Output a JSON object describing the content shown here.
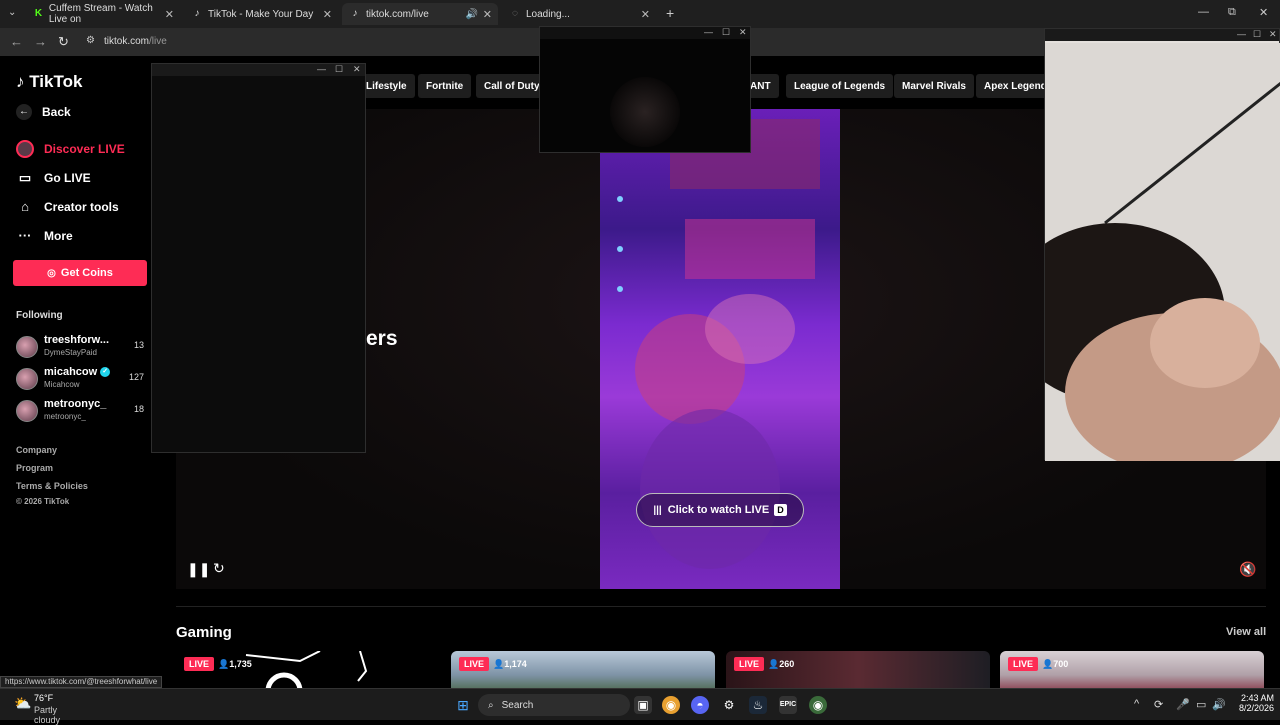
{
  "browser": {
    "tabs": [
      {
        "title": "Cuffem Stream - Watch Live on",
        "icon": "kick-icon"
      },
      {
        "title": "TikTok - Make Your Day",
        "icon": "tiktok-icon"
      },
      {
        "title": "tiktok.com/live",
        "icon": "tiktok-icon",
        "active": true
      },
      {
        "title": "Loading...",
        "icon": "loading-icon"
      }
    ],
    "url_host": "tiktok.com",
    "url_path": "/live"
  },
  "sidebar": {
    "logo": "TikTok",
    "back": "Back",
    "nav": [
      "Discover LIVE",
      "Go LIVE",
      "Creator tools",
      "More"
    ],
    "get_coins": "Get Coins",
    "following_label": "Following",
    "following": [
      {
        "name": "treeshforw...",
        "sub": "DymeStayPaid",
        "count": "13"
      },
      {
        "name": "micahcow",
        "sub": "Micahcow",
        "count": "127",
        "verified": true
      },
      {
        "name": "metroonyc_",
        "sub": "metroonyc_",
        "count": "18"
      }
    ],
    "footer": [
      "Company",
      "Program",
      "Terms & Policies",
      "© 2026 TikTok"
    ]
  },
  "categories": [
    "Lifestyle",
    "Fortnite",
    "Call of Duty",
    "ANT",
    "League of Legends",
    "Marvel Rivals",
    "Apex Legends"
  ],
  "hero": {
    "title_fragment": "ers",
    "watch_label": "Click to watch LIVE",
    "watch_key": "D"
  },
  "gaming": {
    "title": "Gaming",
    "view_all": "View all",
    "cards": [
      {
        "live": "LIVE",
        "viewers": "1,735"
      },
      {
        "live": "LIVE",
        "viewers": "1,174"
      },
      {
        "live": "LIVE",
        "viewers": "260"
      },
      {
        "live": "LIVE",
        "viewers": "700"
      }
    ]
  },
  "status_url": "https://www.tiktok.com/@treeshforwhat/live",
  "taskbar": {
    "temp": "76°F",
    "condition": "Partly cloudy",
    "search": "Search",
    "time": "2:43 AM",
    "date": "8/2/2026"
  },
  "colors": {
    "accent": "#fe2c55",
    "verified": "#20d5ec"
  }
}
